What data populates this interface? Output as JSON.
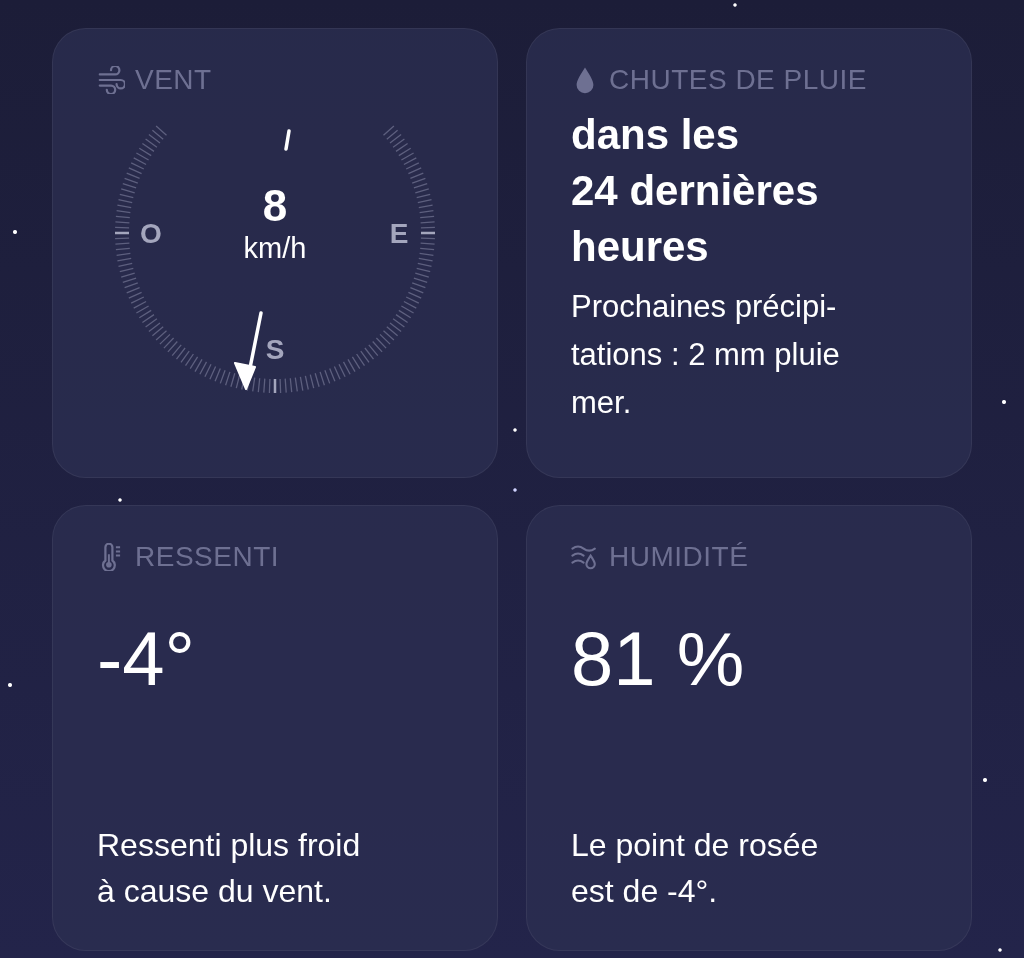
{
  "cards": [
    {
      "kind": "wind",
      "title": "VENT",
      "speed": "8",
      "unit": "km/h",
      "directions": [
        {
          "label": "O",
          "kind": "west"
        },
        {
          "label": "E",
          "kind": "east"
        },
        {
          "label": "S",
          "kind": "south"
        }
      ]
    },
    {
      "kind": "rain",
      "title": "CHUTES DE PLUIE",
      "headline": [
        "dans les",
        "24 dernières",
        "heures"
      ],
      "note": [
        "Prochaines précipi-",
        "tations : 2 mm pluie",
        "mer."
      ]
    },
    {
      "kind": "feels",
      "title": "RESSENTI",
      "value": "-4°",
      "note": [
        "Ressenti plus froid",
        "à cause du vent."
      ]
    },
    {
      "kind": "humidity",
      "title": "HUMIDITÉ",
      "value": "81 %",
      "note": [
        "Le point de rosée",
        "est de -4°."
      ]
    }
  ]
}
